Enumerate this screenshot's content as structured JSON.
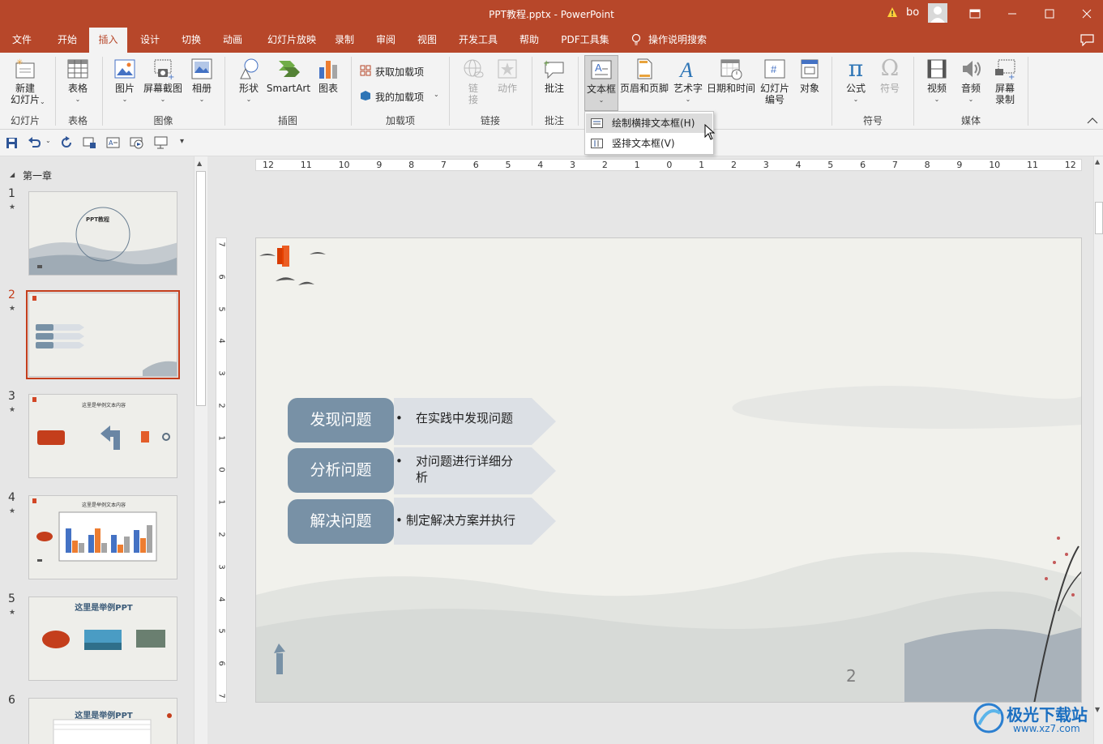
{
  "window": {
    "title": "PPT教程.pptx  -  PowerPoint",
    "user": "bo",
    "warning_icon": "warning-icon"
  },
  "menu": {
    "tabs": [
      "文件",
      "开始",
      "插入",
      "设计",
      "切换",
      "动画",
      "幻灯片放映",
      "录制",
      "审阅",
      "视图",
      "开发工具",
      "帮助",
      "PDF工具集"
    ],
    "active_tab": "插入",
    "search": "操作说明搜索"
  },
  "ribbon": {
    "slides": {
      "new_slide": "新建\n幻灯片",
      "group": "幻灯片"
    },
    "tables": {
      "table": "表格",
      "group": "表格"
    },
    "images": {
      "picture": "图片",
      "screenshot": "屏幕截图",
      "album": "相册",
      "group": "图像"
    },
    "illustrations": {
      "shapes": "形状",
      "smartart": "SmartArt",
      "chart": "图表",
      "group": "插图"
    },
    "addins": {
      "get": "获取加载项",
      "mine": "我的加载项",
      "group": "加载项"
    },
    "links": {
      "link": "链\n接",
      "action": "动作",
      "group": "链接"
    },
    "comments": {
      "comment": "批注",
      "group": "批注"
    },
    "text": {
      "textbox": "文本框",
      "header_footer": "页眉和页脚",
      "wordart": "艺术字",
      "datetime": "日期和时间",
      "slide_number": "幻灯片\n编号",
      "object": "对象"
    },
    "symbols": {
      "equation": "公式",
      "symbol": "符号",
      "group": "符号"
    },
    "media": {
      "video": "视频",
      "audio": "音频",
      "screen_record": "屏幕\n录制",
      "group": "媒体"
    }
  },
  "dropdown": {
    "items": [
      "绘制横排文本框(H)",
      "竖排文本框(V)"
    ],
    "hovered": 0
  },
  "panel": {
    "section": "第一章",
    "slides": [
      {
        "num": "1",
        "title": "PPT教程"
      },
      {
        "num": "2",
        "title": ""
      },
      {
        "num": "3",
        "title": "这里是举例文本内容"
      },
      {
        "num": "4",
        "title": "这里是举例文本内容"
      },
      {
        "num": "5",
        "title": "这里是举例PPT"
      },
      {
        "num": "6",
        "title": "这里是举例PPT"
      }
    ],
    "active": 1
  },
  "ruler": {
    "h_labels": [
      "12",
      "11",
      "10",
      "9",
      "8",
      "7",
      "6",
      "5",
      "4",
      "3",
      "2",
      "1",
      "0",
      "1",
      "2",
      "3",
      "4",
      "5",
      "6",
      "7",
      "8",
      "9",
      "10",
      "11",
      "12"
    ],
    "v_labels": [
      "7",
      "6",
      "5",
      "4",
      "3",
      "2",
      "1",
      "0",
      "1",
      "2",
      "3",
      "4",
      "5",
      "6",
      "7"
    ]
  },
  "slide": {
    "rows": [
      {
        "label": "发现问题",
        "text": "在实践中发现问题"
      },
      {
        "label": "分析问题",
        "text": "对问题进行详细分\n析"
      },
      {
        "label": "解决问题",
        "text": "制定解决方案并执行"
      }
    ],
    "page_number": "2",
    "bullet": "•"
  },
  "watermark": {
    "name": "极光下载站",
    "url": "www.xz7.com"
  },
  "colors": {
    "brand": "#b7472a",
    "pill": "#7891a6",
    "arrow": "#d9dee4"
  }
}
